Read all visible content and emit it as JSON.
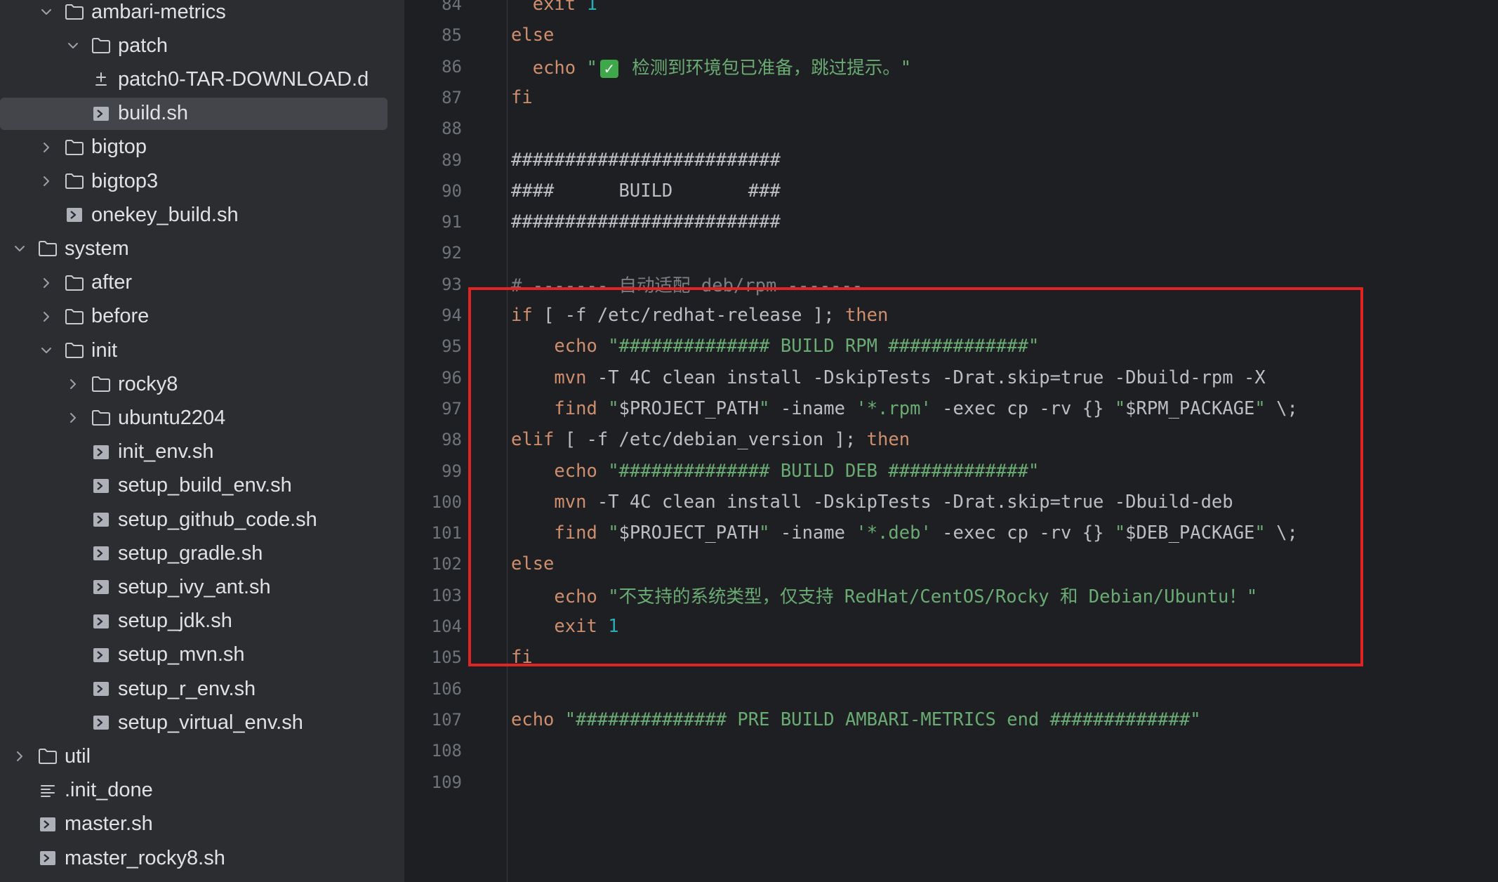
{
  "tree": [
    {
      "label": "ambari-metrics",
      "type": "folder",
      "expanded": true,
      "depth": 1
    },
    {
      "label": "patch",
      "type": "folder",
      "expanded": true,
      "depth": 2
    },
    {
      "label": "patch0-TAR-DOWNLOAD.d",
      "type": "diff",
      "depth": 3
    },
    {
      "label": "build.sh",
      "type": "shell",
      "depth": 3,
      "selected": true
    },
    {
      "label": "bigtop",
      "type": "folder",
      "expanded": false,
      "depth": 1
    },
    {
      "label": "bigtop3",
      "type": "folder",
      "expanded": false,
      "depth": 1
    },
    {
      "label": "onekey_build.sh",
      "type": "shell",
      "depth": 2
    },
    {
      "label": "system",
      "type": "folder",
      "expanded": true,
      "depth": 0
    },
    {
      "label": "after",
      "type": "folder",
      "expanded": false,
      "depth": 1
    },
    {
      "label": "before",
      "type": "folder",
      "expanded": false,
      "depth": 1
    },
    {
      "label": "init",
      "type": "folder",
      "expanded": true,
      "depth": 1
    },
    {
      "label": "rocky8",
      "type": "folder",
      "expanded": false,
      "depth": 2
    },
    {
      "label": "ubuntu2204",
      "type": "folder",
      "expanded": false,
      "depth": 2
    },
    {
      "label": "init_env.sh",
      "type": "shell",
      "depth": 3
    },
    {
      "label": "setup_build_env.sh",
      "type": "shell",
      "depth": 3
    },
    {
      "label": "setup_github_code.sh",
      "type": "shell",
      "depth": 3
    },
    {
      "label": "setup_gradle.sh",
      "type": "shell",
      "depth": 3
    },
    {
      "label": "setup_ivy_ant.sh",
      "type": "shell",
      "depth": 3
    },
    {
      "label": "setup_jdk.sh",
      "type": "shell",
      "depth": 3
    },
    {
      "label": "setup_mvn.sh",
      "type": "shell",
      "depth": 3
    },
    {
      "label": "setup_r_env.sh",
      "type": "shell",
      "depth": 3
    },
    {
      "label": "setup_virtual_env.sh",
      "type": "shell",
      "depth": 3
    },
    {
      "label": "util",
      "type": "folder",
      "expanded": false,
      "depth": 0
    },
    {
      "label": ".init_done",
      "type": "text",
      "depth": 1
    },
    {
      "label": "master.sh",
      "type": "shell",
      "depth": 1
    },
    {
      "label": "master_rocky8.sh",
      "type": "shell",
      "depth": 1
    }
  ],
  "editor": {
    "lines": [
      {
        "n": "84",
        "tokens": [
          [
            "plain",
            "  "
          ],
          [
            "kw",
            "exit"
          ],
          [
            "plain",
            " "
          ],
          [
            "num",
            "1"
          ]
        ]
      },
      {
        "n": "85",
        "tokens": [
          [
            "kw",
            "else"
          ]
        ]
      },
      {
        "n": "86",
        "tokens": [
          [
            "plain",
            "  "
          ],
          [
            "kw",
            "echo"
          ],
          [
            "plain",
            " "
          ],
          [
            "str",
            "\""
          ],
          [
            "check",
            "✓"
          ],
          [
            "str",
            " 检测到环境包已准备，跳过提示。\""
          ]
        ]
      },
      {
        "n": "87",
        "tokens": [
          [
            "kw",
            "fi"
          ]
        ]
      },
      {
        "n": "88",
        "tokens": []
      },
      {
        "n": "89",
        "tokens": [
          [
            "plain",
            "#########################"
          ]
        ]
      },
      {
        "n": "90",
        "tokens": [
          [
            "plain",
            "####      BUILD       ###"
          ]
        ]
      },
      {
        "n": "91",
        "tokens": [
          [
            "plain",
            "#########################"
          ]
        ]
      },
      {
        "n": "92",
        "tokens": []
      },
      {
        "n": "93",
        "tokens": [
          [
            "cmt",
            "# ------- 自动适配 deb/rpm -------"
          ]
        ]
      },
      {
        "n": "94",
        "tokens": [
          [
            "kw",
            "if"
          ],
          [
            "plain",
            " [ -f /etc/redhat-release ]; "
          ],
          [
            "kw",
            "then"
          ]
        ]
      },
      {
        "n": "95",
        "tokens": [
          [
            "plain",
            "    "
          ],
          [
            "kw",
            "echo"
          ],
          [
            "plain",
            " "
          ],
          [
            "str",
            "\"############## BUILD RPM #############\""
          ]
        ]
      },
      {
        "n": "96",
        "tokens": [
          [
            "plain",
            "    "
          ],
          [
            "kw",
            "mvn"
          ],
          [
            "plain",
            " -T 4C clean install -DskipTests -Drat.skip=true -Dbuild-rpm -X"
          ]
        ]
      },
      {
        "n": "97",
        "tokens": [
          [
            "plain",
            "    "
          ],
          [
            "kw",
            "find"
          ],
          [
            "plain",
            " "
          ],
          [
            "str",
            "\""
          ],
          [
            "plain",
            "$PROJECT_PATH"
          ],
          [
            "str",
            "\""
          ],
          [
            "plain",
            " -iname "
          ],
          [
            "str",
            "'*.rpm'"
          ],
          [
            "plain",
            " -exec cp -rv {} "
          ],
          [
            "str",
            "\""
          ],
          [
            "plain",
            "$RPM_PACKAGE"
          ],
          [
            "str",
            "\""
          ],
          [
            "plain",
            " \\;"
          ]
        ]
      },
      {
        "n": "98",
        "tokens": [
          [
            "kw",
            "elif"
          ],
          [
            "plain",
            " [ -f /etc/debian_version ]; "
          ],
          [
            "kw",
            "then"
          ]
        ]
      },
      {
        "n": "99",
        "tokens": [
          [
            "plain",
            "    "
          ],
          [
            "kw",
            "echo"
          ],
          [
            "plain",
            " "
          ],
          [
            "str",
            "\"############## BUILD DEB #############\""
          ]
        ]
      },
      {
        "n": "100",
        "tokens": [
          [
            "plain",
            "    "
          ],
          [
            "kw",
            "mvn"
          ],
          [
            "plain",
            " -T 4C clean install -DskipTests -Drat.skip=true -Dbuild-deb"
          ]
        ]
      },
      {
        "n": "101",
        "tokens": [
          [
            "plain",
            "    "
          ],
          [
            "kw",
            "find"
          ],
          [
            "plain",
            " "
          ],
          [
            "str",
            "\""
          ],
          [
            "plain",
            "$PROJECT_PATH"
          ],
          [
            "str",
            "\""
          ],
          [
            "plain",
            " -iname "
          ],
          [
            "str",
            "'*.deb'"
          ],
          [
            "plain",
            " -exec cp -rv {} "
          ],
          [
            "str",
            "\""
          ],
          [
            "plain",
            "$DEB_PACKAGE"
          ],
          [
            "str",
            "\""
          ],
          [
            "plain",
            " \\;"
          ]
        ]
      },
      {
        "n": "102",
        "tokens": [
          [
            "kw",
            "else"
          ]
        ]
      },
      {
        "n": "103",
        "tokens": [
          [
            "plain",
            "    "
          ],
          [
            "kw",
            "echo"
          ],
          [
            "plain",
            " "
          ],
          [
            "str",
            "\"不支持的系统类型，仅支持 RedHat/CentOS/Rocky 和 Debian/Ubuntu！\""
          ]
        ]
      },
      {
        "n": "104",
        "tokens": [
          [
            "plain",
            "    "
          ],
          [
            "kw",
            "exit"
          ],
          [
            "plain",
            " "
          ],
          [
            "num",
            "1"
          ]
        ]
      },
      {
        "n": "105",
        "tokens": [
          [
            "kw",
            "fi"
          ]
        ]
      },
      {
        "n": "106",
        "tokens": []
      },
      {
        "n": "107",
        "tokens": [
          [
            "kw",
            "echo"
          ],
          [
            "plain",
            " "
          ],
          [
            "str",
            "\"############## PRE BUILD AMBARI-METRICS end #############\""
          ]
        ]
      },
      {
        "n": "108",
        "tokens": []
      },
      {
        "n": "109",
        "tokens": []
      }
    ]
  },
  "colors": {
    "sidebar_bg": "#2b2d30",
    "editor_bg": "#1e1f22",
    "keyword": "#cf8e6d",
    "string": "#6aab73",
    "number": "#2aacb8",
    "comment": "#7a7e85",
    "plain": "#bcbec4",
    "highlight_border": "#e02424"
  }
}
